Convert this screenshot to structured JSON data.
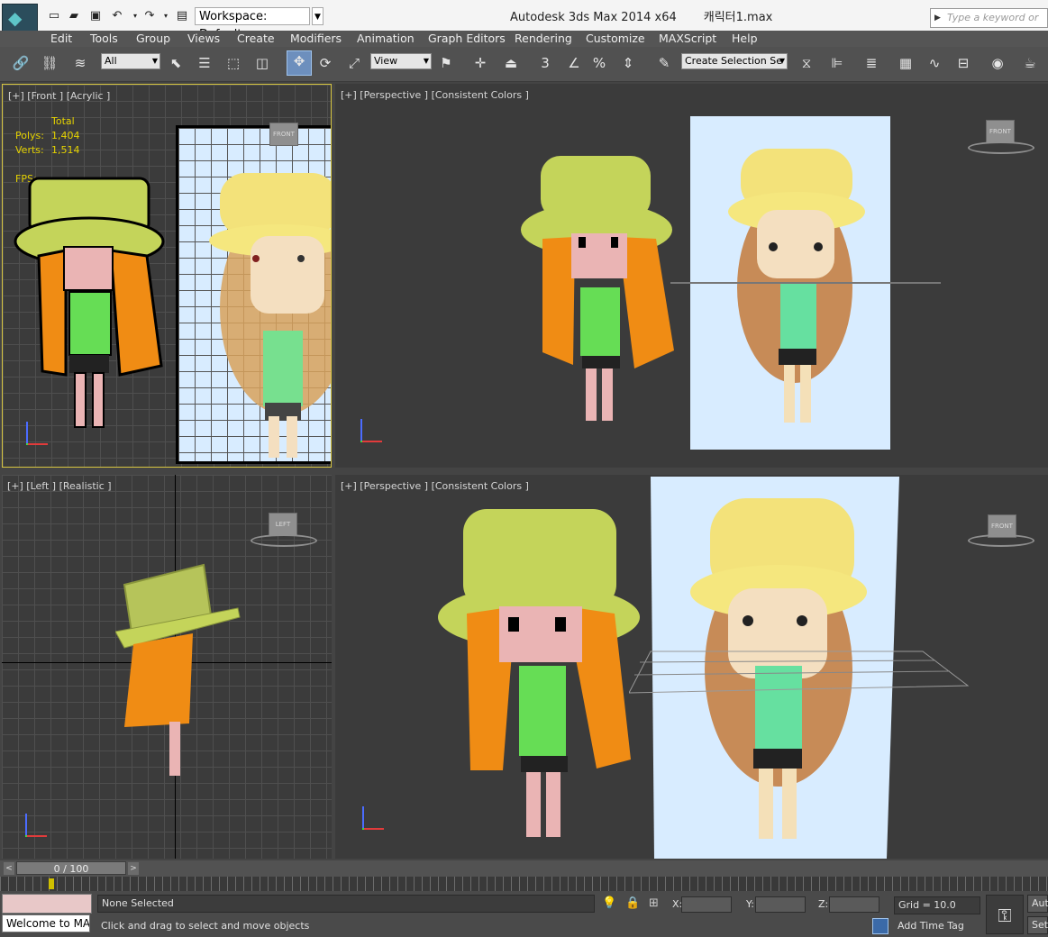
{
  "titlebar": {
    "workspace": "Workspace: Default",
    "app_title": "Autodesk 3ds Max  2014 x64",
    "file_name": "캐릭터1.max",
    "search_placeholder": "Type a keyword or phi"
  },
  "menu": [
    "Edit",
    "Tools",
    "Group",
    "Views",
    "Create",
    "Modifiers",
    "Animation",
    "Graph Editors",
    "Rendering",
    "Customize",
    "MAXScript",
    "Help"
  ],
  "toolbar": {
    "selection_filter": "All",
    "ref_coord": "View",
    "named_selection": "Create Selection Se",
    "snap_3": "3",
    "percent": "%"
  },
  "viewports": {
    "top_left": {
      "label": "[+] [Front ] [Acrylic ]",
      "stats_header": "Total",
      "polys_label": "Polys:",
      "polys_value": "1,404",
      "verts_label": "Verts:",
      "verts_value": "1,514",
      "fps_label": "FPS:",
      "cube": "FRONT"
    },
    "top_right": {
      "label": "[+] [Perspective ] [Consistent Colors ]",
      "cube": "FRONT"
    },
    "bottom_left": {
      "label": "[+] [Left ] [Realistic ]",
      "cube": "LEFT"
    },
    "bottom_right": {
      "label": "[+] [Perspective ] [Consistent Colors ]",
      "cube": "FRONT"
    }
  },
  "timeline": {
    "frame": "0 / 100",
    "prev": "<",
    "next": ">"
  },
  "status": {
    "welcome": "Welcome to MA",
    "selection": "None Selected",
    "prompt": "Click and drag to select and move objects",
    "x_label": "X:",
    "y_label": "Y:",
    "z_label": "Z:",
    "grid": "Grid = 10.0",
    "add_time_tag": "Add Time Tag",
    "auto": "Auto",
    "set": "Set"
  },
  "colors": {
    "hat": "#c4d45a",
    "hair": "#f08c14",
    "shirt": "#66dd55",
    "skin": "#eab4b4",
    "hud": "#e6d300"
  }
}
